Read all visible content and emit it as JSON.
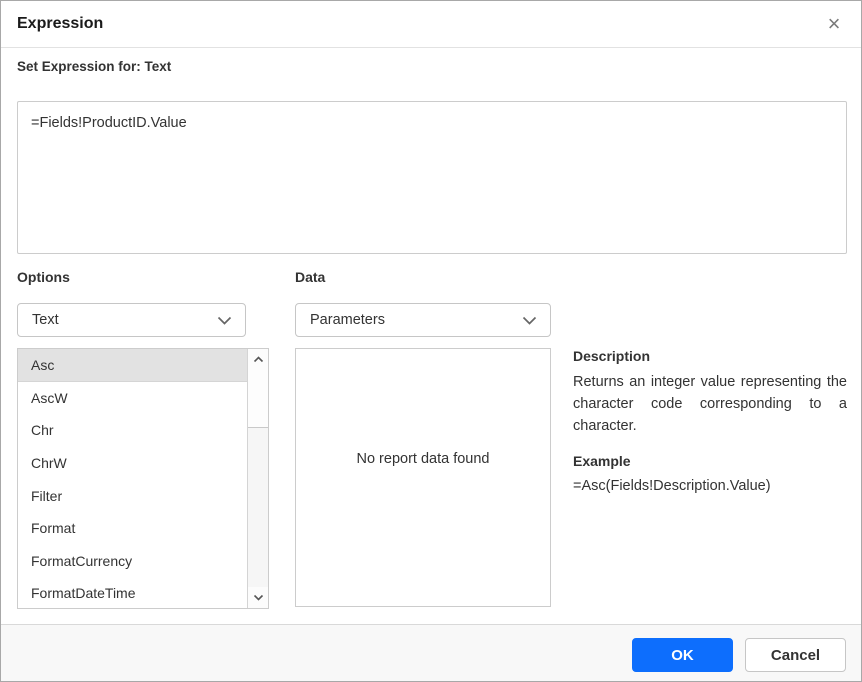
{
  "dialog": {
    "title": "Expression",
    "set_expression_label": "Set Expression for: Text",
    "expression_value": "=Fields!ProductID.Value"
  },
  "options": {
    "label": "Options",
    "selected": "Text",
    "selected_function": "Asc",
    "functions": [
      "Asc",
      "AscW",
      "Chr",
      "ChrW",
      "Filter",
      "Format",
      "FormatCurrency",
      "FormatDateTime"
    ]
  },
  "data": {
    "label": "Data",
    "selected": "Parameters",
    "empty_message": "No report data found"
  },
  "description": {
    "heading": "Description",
    "text": "Returns an integer value representing the character code corresponding to a character.",
    "example_heading": "Example",
    "example_value": "=Asc(Fields!Description.Value)"
  },
  "footer": {
    "ok_label": "OK",
    "cancel_label": "Cancel"
  },
  "icons": {
    "close": "×",
    "dropdown_chevron": "chevron-down",
    "scroll_up": "chevron-up",
    "scroll_down": "chevron-down"
  },
  "colors": {
    "primary_button": "#0d6efd",
    "selected_item_bg": "#e2e2e2",
    "border": "#cccccc",
    "footer_bg": "#f8f8f8"
  }
}
